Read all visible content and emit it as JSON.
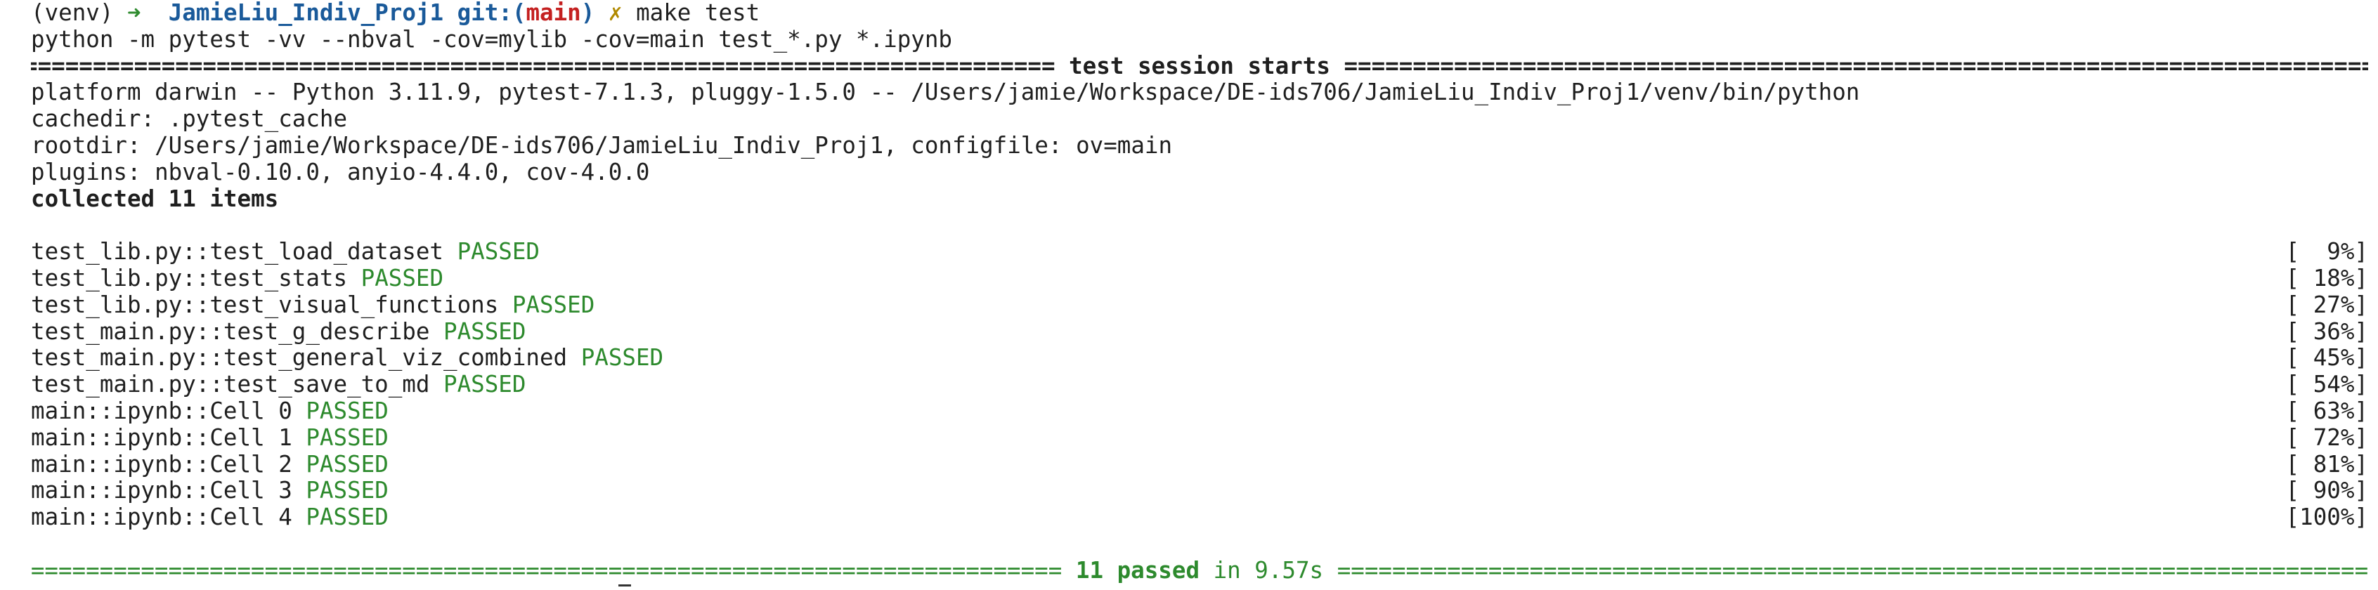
{
  "prompt": {
    "venv": "(venv)",
    "arrow": "➜",
    "repo": "JamieLiu_Indiv_Proj1",
    "git_label": "git:",
    "paren_open": "(",
    "branch": "main",
    "paren_close": ")",
    "dirty_mark": "✗",
    "command": "make test"
  },
  "command_echo": "python -m pytest -vv --nbval -cov=mylib -cov=main test_*.py *.ipynb",
  "session_header": {
    "title": " test session starts ",
    "rule_char": "="
  },
  "platform_info": [
    "platform darwin -- Python 3.11.9, pytest-7.1.3, pluggy-1.5.0 -- /Users/jamie/Workspace/DE-ids706/JamieLiu_Indiv_Proj1/venv/bin/python",
    "cachedir: .pytest_cache",
    "rootdir: /Users/jamie/Workspace/DE-ids706/JamieLiu_Indiv_Proj1, configfile: ov=main",
    "plugins: nbval-0.10.0, anyio-4.4.0, cov-4.0.0"
  ],
  "collected": "collected 11 items",
  "tests": [
    {
      "name": "test_lib.py::test_load_dataset",
      "status": "PASSED",
      "pct": "[  9%]"
    },
    {
      "name": "test_lib.py::test_stats",
      "status": "PASSED",
      "pct": "[ 18%]"
    },
    {
      "name": "test_lib.py::test_visual_functions",
      "status": "PASSED",
      "pct": "[ 27%]"
    },
    {
      "name": "test_main.py::test_g_describe",
      "status": "PASSED",
      "pct": "[ 36%]"
    },
    {
      "name": "test_main.py::test_general_viz_combined",
      "status": "PASSED",
      "pct": "[ 45%]"
    },
    {
      "name": "test_main.py::test_save_to_md",
      "status": "PASSED",
      "pct": "[ 54%]"
    },
    {
      "name": "main::ipynb::Cell 0",
      "status": "PASSED",
      "pct": "[ 63%]"
    },
    {
      "name": "main::ipynb::Cell 1",
      "status": "PASSED",
      "pct": "[ 72%]"
    },
    {
      "name": "main::ipynb::Cell 2",
      "status": "PASSED",
      "pct": "[ 81%]"
    },
    {
      "name": "main::ipynb::Cell 3",
      "status": "PASSED",
      "pct": "[ 90%]"
    },
    {
      "name": "main::ipynb::Cell 4",
      "status": "PASSED",
      "pct": "[100%]"
    }
  ],
  "summary": {
    "passed": "11 passed",
    "in_text": " in 9.57s "
  },
  "colors": {
    "pass_green": "#2d8a2d",
    "branch_red": "#c42020",
    "repo_blue": "#1a5a9a",
    "prompt_arrow": "#2e8b2e"
  }
}
